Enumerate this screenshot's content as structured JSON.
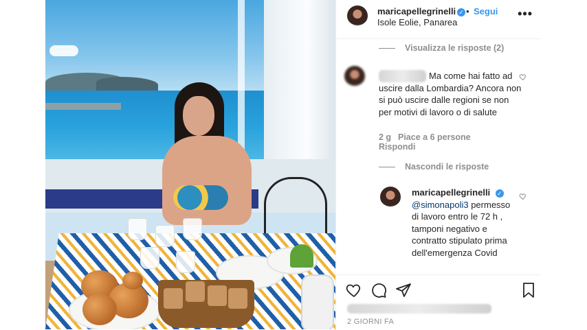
{
  "post": {
    "username": "maricapellegrinelli",
    "follow_label": "Segui",
    "dot": "•",
    "location": "Isole Eolie, Panarea",
    "more_label": "•••"
  },
  "comments": {
    "view_replies": "Visualizza le risposte (2)",
    "comment1": {
      "author": "simonapoli3",
      "text_line1": "Ma come hai fatto",
      "text_rest": "ad uscire dalla Lombardia? Ancora non si può uscire dalle regioni se non per motivi di lavoro o di salute",
      "time": "2 g",
      "likes": "Piace a 6 persone",
      "reply_label": "Rispondi"
    },
    "hide_replies": "Nascondi le risposte",
    "reply1": {
      "author": "maricapellegrinelli",
      "mention": "@simonapoli3",
      "text": "permesso di lavoro entro le 72 h , tamponi negativo e contratto stipulato prima dell'emergenza Covid"
    }
  },
  "footer": {
    "date": "2 GIORNI FA"
  },
  "icons": {
    "verified": "verified-badge-icon",
    "heart": "heart-icon",
    "comment": "comment-icon",
    "share": "share-icon",
    "bookmark": "bookmark-icon"
  },
  "colors": {
    "accent": "#3897f0",
    "muted": "#8e8e8e",
    "text": "#262626",
    "mention": "#00376b"
  }
}
